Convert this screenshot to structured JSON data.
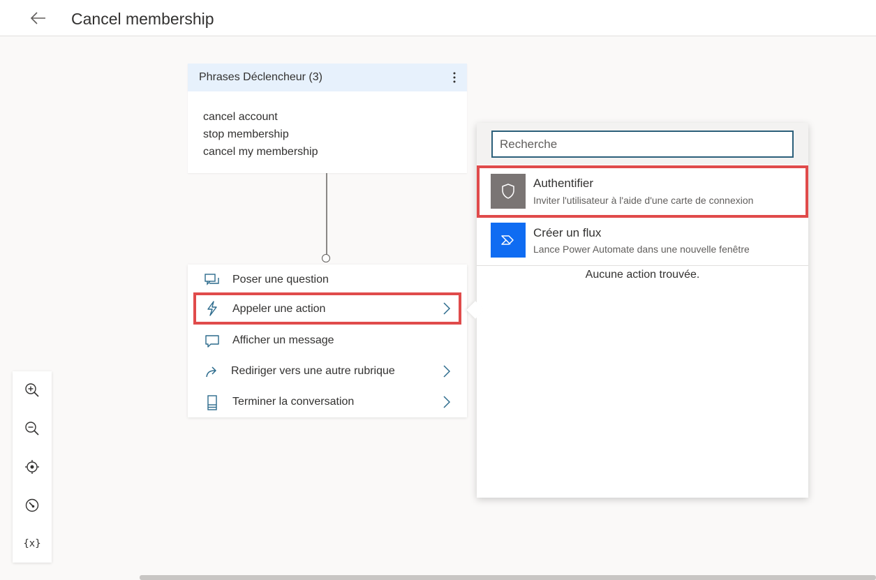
{
  "header": {
    "title": "Cancel membership"
  },
  "trigger": {
    "title": "Phrases Déclencheur (3)",
    "phrases": [
      "cancel account",
      "stop membership",
      "cancel my membership"
    ]
  },
  "node_menu": {
    "items": [
      {
        "label": "Poser une question",
        "icon": "chat-question-icon",
        "has_submenu": false
      },
      {
        "label": "Appeler une action",
        "icon": "lightning-icon",
        "has_submenu": true,
        "selected": true
      },
      {
        "label": "Afficher un message",
        "icon": "message-icon",
        "has_submenu": false
      },
      {
        "label": "Rediriger vers une autre rubrique",
        "icon": "redirect-arrow-icon",
        "has_submenu": true
      },
      {
        "label": "Terminer la conversation",
        "icon": "end-conversation-icon",
        "has_submenu": true
      }
    ]
  },
  "action_popup": {
    "search_placeholder": "Recherche",
    "actions": [
      {
        "title": "Authentifier",
        "description": "Inviter l'utilisateur à l'aide d'une carte de connexion",
        "icon": "shield-icon",
        "icon_bg": "#7a7574",
        "highlighted": true
      },
      {
        "title": "Créer un flux",
        "description": "Lance Power Automate dans une nouvelle fenêtre",
        "icon": "power-automate-icon",
        "icon_bg": "#0f6cf2"
      }
    ],
    "empty_message": "Aucune action trouvée."
  },
  "zoom_toolbar": {
    "items": [
      "zoom-in-icon",
      "zoom-out-icon",
      "recenter-icon",
      "minimap-icon",
      "variables-icon"
    ],
    "variables_label": "{x}"
  },
  "colors": {
    "highlight": "#e04b4b",
    "accent": "#0f6cf2",
    "trigger_header": "#e7f1fc"
  }
}
